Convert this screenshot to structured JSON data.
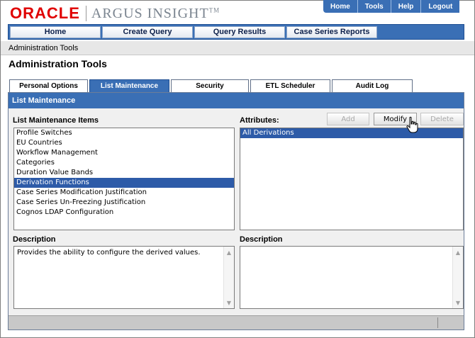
{
  "brand": {
    "oracle": "ORACLE",
    "product": "ARGUS INSIGHT",
    "tm": "TM"
  },
  "global_nav": [
    "Home",
    "Tools",
    "Help",
    "Logout"
  ],
  "main_menu": [
    "Home",
    "Create Query",
    "Query Results",
    "Case Series Reports"
  ],
  "breadcrumb": "Administration Tools",
  "page_title": "Administration Tools",
  "tabs": [
    "Personal Options",
    "List Maintenance",
    "Security",
    "ETL Scheduler",
    "Audit Log"
  ],
  "active_tab": "List Maintenance",
  "panel": {
    "title": "List Maintenance",
    "items_label": "List Maintenance Items",
    "attributes_label": "Attributes:",
    "buttons": {
      "add": "Add",
      "modify": "Modify",
      "delete": "Delete"
    },
    "items": [
      "Profile Switches",
      "EU Countries",
      "Workflow Management",
      "Categories",
      "Duration Value Bands",
      "Derivation Functions",
      "Case Series Modification Justification",
      "Case Series Un-Freezing Justification",
      "Cognos LDAP Configuration"
    ],
    "selected_item": "Derivation Functions",
    "attributes": [
      "All Derivations"
    ],
    "selected_attribute": "All Derivations",
    "description_label_left": "Description",
    "description_label_right": "Description",
    "description_text": "Provides the ability to configure the derived values.",
    "attribute_description_text": ""
  },
  "colors": {
    "accent": "#3a6fb5",
    "selection": "#2d5ba8",
    "brand_red": "#e00000"
  },
  "icons": {
    "cursor": "hand-pointer-icon",
    "scroll_up": "scroll-up-arrow-icon",
    "scroll_down": "scroll-down-arrow-icon"
  }
}
